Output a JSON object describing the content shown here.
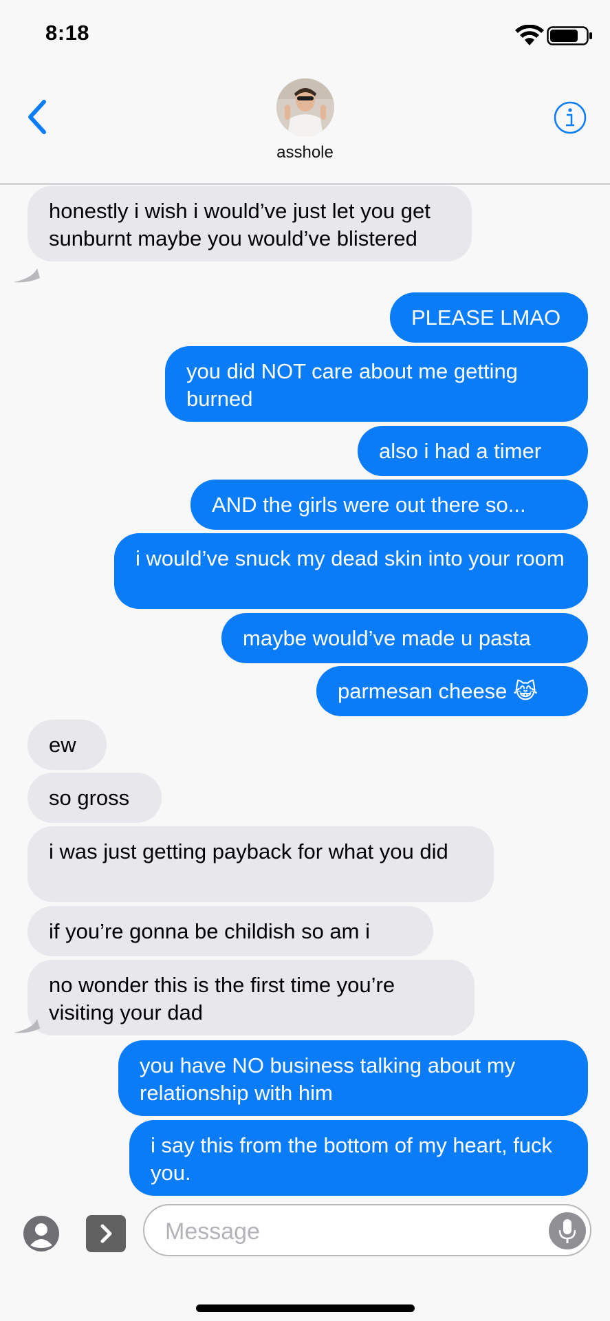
{
  "status_bar": {
    "time": "8:18",
    "wifi_icon": "wifi-icon",
    "battery_icon": "battery-icon"
  },
  "header": {
    "back_icon": "chevron-left-icon",
    "contact_name": "asshole",
    "info_icon": "info-icon",
    "accent_color": "#0a7cf8"
  },
  "messages": [
    {
      "side": "in",
      "text": "honestly i wish i would’ve just let you get sunburnt maybe you would’ve blistered"
    },
    {
      "side": "out",
      "text": "PLEASE LMAO"
    },
    {
      "side": "out",
      "text": "you did NOT care about me getting burned"
    },
    {
      "side": "out",
      "text": "also i had a timer"
    },
    {
      "side": "out",
      "text": "AND the girls were out there so..."
    },
    {
      "side": "out",
      "text": "i would’ve snuck my dead skin into your room"
    },
    {
      "side": "out",
      "text": "maybe would’ve made u pasta"
    },
    {
      "side": "out",
      "text": "parmesan cheese 😹"
    },
    {
      "side": "in",
      "text": "ew"
    },
    {
      "side": "in",
      "text": "so gross"
    },
    {
      "side": "in",
      "text": "i was just getting payback for what you did"
    },
    {
      "side": "in",
      "text": "if you’re gonna be childish so am i"
    },
    {
      "side": "in",
      "text": "no wonder this is the first time you’re visiting your dad"
    },
    {
      "side": "out",
      "text": "you have NO business talking about my relationship with him"
    },
    {
      "side": "out",
      "text": "i say this from the bottom of my heart, fuck you."
    }
  ],
  "colors": {
    "incoming_bubble": "#e8e7ec",
    "outgoing_bubble": "#0a7cf8"
  },
  "input_bar": {
    "placeholder": "Message",
    "contact_icon": "person-icon",
    "apps_icon": "chevron-right-icon",
    "mic_icon": "microphone-icon"
  }
}
